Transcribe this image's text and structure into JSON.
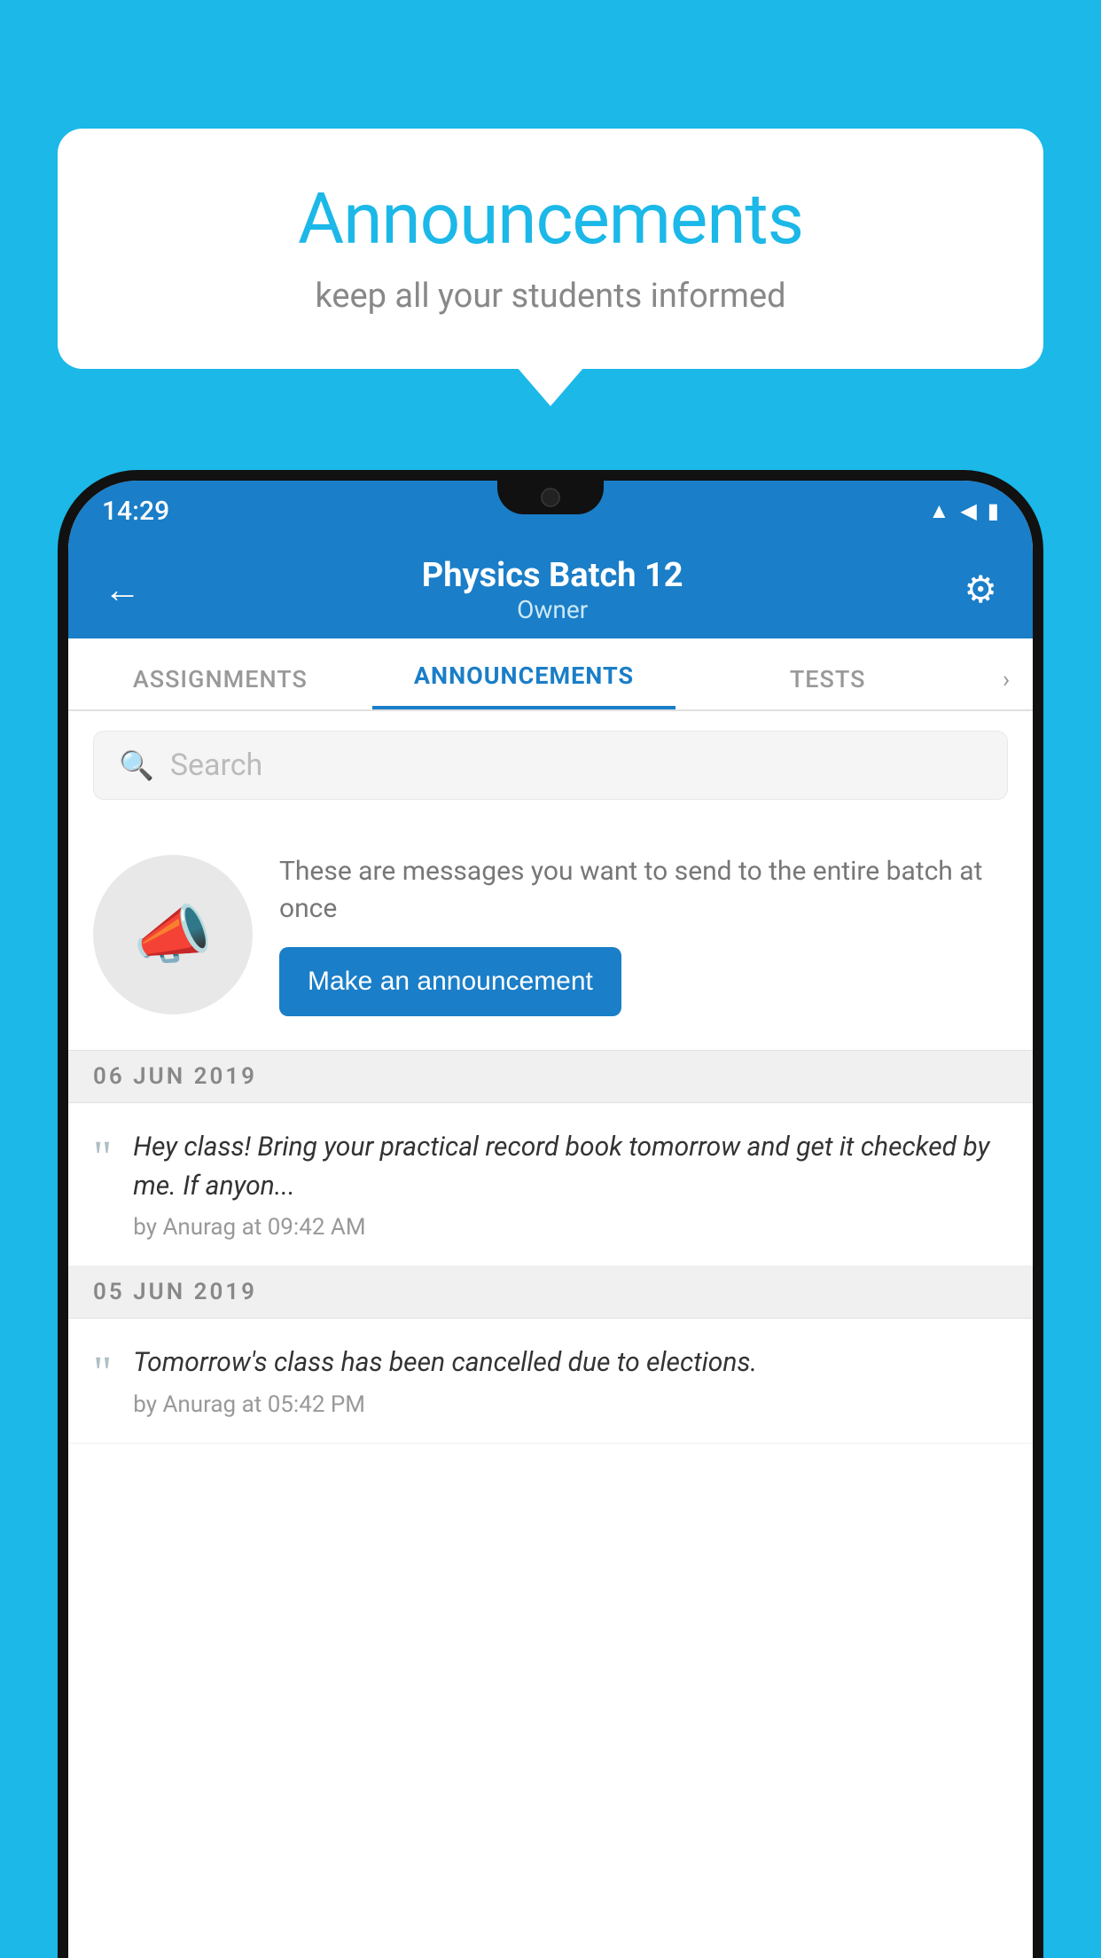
{
  "background_color": "#1bb8e8",
  "speech_bubble": {
    "title": "Announcements",
    "subtitle": "keep all your students informed"
  },
  "phone": {
    "status_bar": {
      "time": "14:29",
      "wifi_icon": "wifi",
      "signal_icon": "signal",
      "battery_icon": "battery"
    },
    "app_bar": {
      "back_icon": "←",
      "title": "Physics Batch 12",
      "subtitle": "Owner",
      "settings_icon": "⚙"
    },
    "tabs": [
      {
        "label": "ASSIGNMENTS",
        "active": false
      },
      {
        "label": "ANNOUNCEMENTS",
        "active": true
      },
      {
        "label": "TESTS",
        "active": false
      }
    ],
    "search": {
      "placeholder": "Search"
    },
    "promo": {
      "description": "These are messages you want to send to the entire batch at once",
      "button_label": "Make an announcement"
    },
    "announcements": [
      {
        "date": "06  JUN  2019",
        "message": "Hey class! Bring your practical record book tomorrow and get it checked by me. If anyon...",
        "meta": "by Anurag at 09:42 AM"
      },
      {
        "date": "05  JUN  2019",
        "message": "Tomorrow's class has been cancelled due to elections.",
        "meta": "by Anurag at 05:42 PM"
      }
    ]
  }
}
